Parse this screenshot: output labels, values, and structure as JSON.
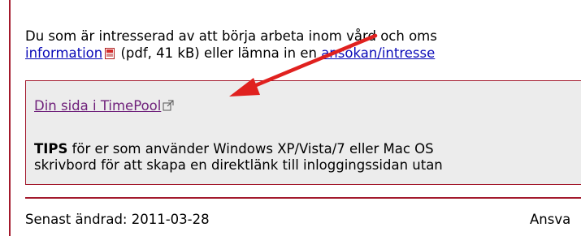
{
  "intro": {
    "line1": "Du som är intresserad av att börja arbeta inom vård och oms",
    "link_information": "information",
    "pdf_meta": " (pdf, 41 kB) eller lämna in en ",
    "link_application": "ansökan/intresse"
  },
  "box": {
    "link_label": "Din sida i TimePool",
    "tips_bold": "TIPS",
    "tips_line1_rest": " för er som använder Windows XP/Vista/7 eller Mac OS",
    "tips_line2": "skrivbord för att skapa en direktlänk till inloggingssidan utan"
  },
  "footer": {
    "last_modified": "Senast ändrad: 2011-03-28",
    "responsible": "Ansva"
  },
  "colors": {
    "accent_red": "#a3192c",
    "link_blue": "#0a0ab8",
    "visited_link": "#6e1f7a",
    "box_bg": "#ececec",
    "arrow_red": "#e0211f"
  },
  "icons": {
    "pdf": "pdf-icon",
    "external_link": "external-link-icon",
    "annotation": "red-arrow-annotation"
  }
}
